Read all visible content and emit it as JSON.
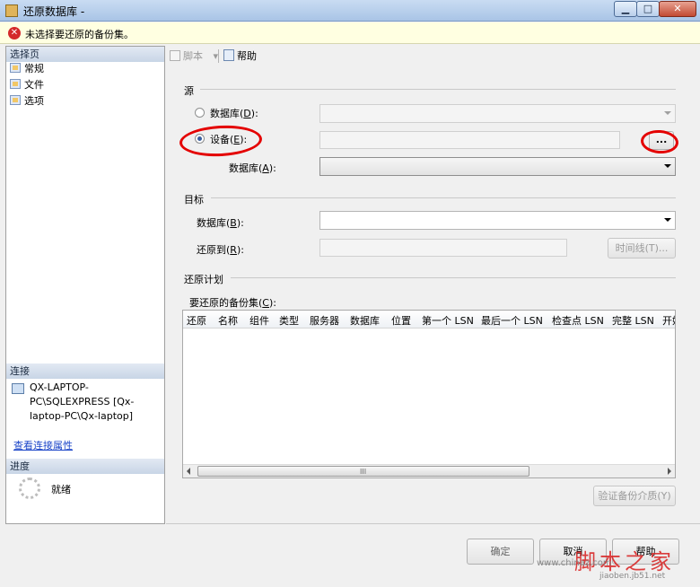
{
  "window": {
    "title": "还原数据库 -",
    "min_glyph": "▁",
    "max_glyph": "□",
    "close_glyph": "✕"
  },
  "error_bar": {
    "icon": "error-icon",
    "message": "未选择要还原的备份集。"
  },
  "sidebar": {
    "select_page_header": "选择页",
    "items": [
      {
        "label": "常规",
        "icon": "page-icon"
      },
      {
        "label": "文件",
        "icon": "page-icon"
      },
      {
        "label": "选项",
        "icon": "page-icon"
      }
    ],
    "connection_header": "连接",
    "connection_text": "QX-LAPTOP-PC\\SQLEXPRESS [Qx-laptop-PC\\Qx-laptop]",
    "connection_link": "查看连接属性",
    "progress_header": "进度",
    "progress_status": "就绪"
  },
  "toolbar": {
    "script_label": "脚本",
    "script_dropdown": "▾",
    "help_label": "帮助"
  },
  "source": {
    "group_label": "源",
    "database_radio": {
      "label": "数据库",
      "key": "D",
      "checked": false
    },
    "device_radio": {
      "label": "设备",
      "key": "E",
      "checked": true
    },
    "browse_button": "...",
    "database_field": {
      "label": "数据库",
      "key": "A",
      "value": ""
    }
  },
  "target": {
    "group_label": "目标",
    "database_field": {
      "label": "数据库",
      "key": "B",
      "value": ""
    },
    "restore_to_field": {
      "label": "还原到",
      "key": "R",
      "value": ""
    },
    "timeline_button": "时间线(T)..."
  },
  "plan": {
    "group_label": "还原计划",
    "backup_sets_label": "要还原的备份集",
    "backup_sets_key": "C",
    "columns": [
      "还原",
      "名称",
      "组件",
      "类型",
      "服务器",
      "数据库",
      "位置",
      "第一个 LSN",
      "最后一个 LSN",
      "检查点 LSN",
      "完整 LSN",
      "开始"
    ],
    "rows": [],
    "scroll_grip": "III",
    "verify_button": "验证备份介质(Y)"
  },
  "footer": {
    "ok_button": "确定",
    "cancel_button": "取消",
    "help_button": "帮助"
  },
  "watermark": {
    "logo": "脚本之家",
    "url": "www.chinaz.com",
    "sub": "jiaoben.jb51.net"
  },
  "colors": {
    "annotation": "#e40000",
    "error_icon": "#d42a2a",
    "link": "#1a44c8"
  }
}
